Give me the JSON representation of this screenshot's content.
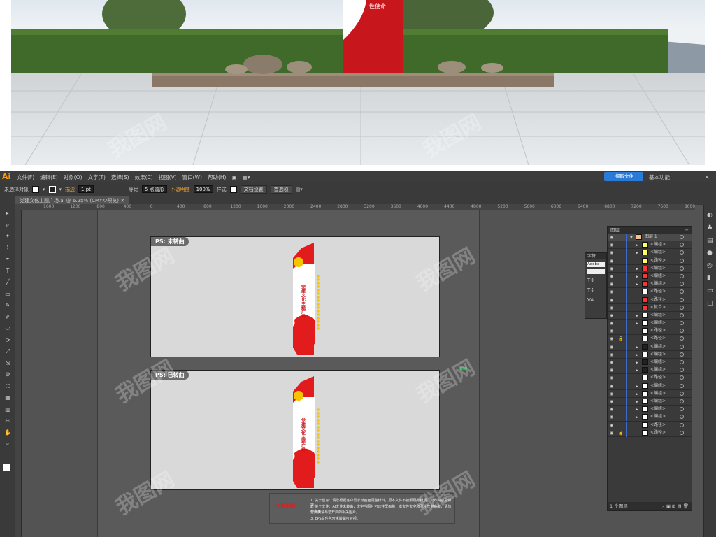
{
  "app": {
    "logo": "Ai",
    "menus": [
      "文件(F)",
      "编辑(E)",
      "对象(O)",
      "文字(T)",
      "选择(S)",
      "效果(C)",
      "视图(V)",
      "窗口(W)",
      "帮助(H)"
    ],
    "cloud_button": "摄取文件",
    "workspace": "基本功能"
  },
  "options_bar": {
    "selection": "未选择对象",
    "stroke_label": "描边",
    "stroke_weight": "1 pt",
    "stroke_style": "等比",
    "brush": "5 点圆形",
    "opacity_label": "不透明度",
    "opacity_value": "100%",
    "style_label": "样式",
    "doc_setup": "文档设置",
    "preferences": "首选项"
  },
  "document": {
    "tab": "党建文化主题广场.ai @ 6.25% (CMYK/预览)",
    "ruler_ticks": [
      "1600",
      "1200",
      "800",
      "400",
      "0",
      "400",
      "800",
      "1200",
      "1600",
      "2000",
      "2400",
      "2800",
      "3200",
      "3600",
      "4000",
      "4400",
      "4800",
      "5200",
      "5600",
      "6000",
      "6400",
      "6800",
      "7200",
      "7600",
      "8000"
    ]
  },
  "artboards": [
    {
      "label": "PS: 未转曲",
      "sign_title": "党建文化主题广场"
    },
    {
      "label": "PS: 已转曲",
      "sign_title": "党建文化主题广场"
    }
  ],
  "file_note": {
    "heading": "文件说明:",
    "lines": [
      "1. 关于创意：请您根据客户需求对画面调整材料，原本文件不按照原有材质，公布内容是做排。",
      "2. 关于文件：AI文件未转曲，文字当图片可以往里面拖，本文件文字和图片仅供参考，请勿在商用",
      "         您负责请与您开启的相关图片。",
      "3. EPS文件包含未转曲可对视。"
    ]
  },
  "char_panel": {
    "title": "字符",
    "font": "Adobe"
  },
  "layers": {
    "title": "图层",
    "footer": "1 个图层",
    "rows": [
      {
        "name": "图层 1",
        "thumb": "#f0c090",
        "top": true
      },
      {
        "name": "<编组>",
        "thumb": "#ffff66",
        "arrow": true
      },
      {
        "name": "<编组>",
        "thumb": "#ffff66",
        "arrow": true
      },
      {
        "name": "<路径>",
        "thumb": "#ffff66"
      },
      {
        "name": "<编组>",
        "thumb": "#ff3333",
        "arrow": true
      },
      {
        "name": "<编组>",
        "thumb": "#ff3333",
        "arrow": true
      },
      {
        "name": "<编组>",
        "thumb": "#ff3333",
        "arrow": true
      },
      {
        "name": "<路径>",
        "thumb": "#ffffff"
      },
      {
        "name": "<路径>",
        "thumb": "#ff3333"
      },
      {
        "name": "<复合>",
        "thumb": "#ff3333"
      },
      {
        "name": "<编组>",
        "thumb": "#ffffff",
        "arrow": true
      },
      {
        "name": "<编组>",
        "thumb": "#ffffff",
        "arrow": true
      },
      {
        "name": "<路径>",
        "thumb": "#ffffff"
      },
      {
        "name": "<路径>",
        "thumb": "#ffffff",
        "locked": true
      },
      {
        "name": "<编组>",
        "thumb": "#222222",
        "arrow": true
      },
      {
        "name": "<编组>",
        "thumb": "#ffffff",
        "arrow": true
      },
      {
        "name": "<编组>",
        "thumb": "#222222",
        "arrow": true
      },
      {
        "name": "<编组>",
        "thumb": "#222222",
        "arrow": true
      },
      {
        "name": "<路径>",
        "thumb": "#ffffff"
      },
      {
        "name": "<编组>",
        "thumb": "#ffffff",
        "arrow": true
      },
      {
        "name": "<编组>",
        "thumb": "#ffffff",
        "arrow": true
      },
      {
        "name": "<编组>",
        "thumb": "#ffffff",
        "arrow": true
      },
      {
        "name": "<编组>",
        "thumb": "#ffffff",
        "arrow": true
      },
      {
        "name": "<编组>",
        "thumb": "#ffffff",
        "arrow": true
      },
      {
        "name": "<路径>",
        "thumb": "#ffffff"
      },
      {
        "name": "<路径>",
        "thumb": "#ffffff",
        "locked": true
      }
    ]
  },
  "colors": {
    "party_red": "#e21c1c",
    "gold": "#f5c400",
    "ui_dark": "#3a3a3a",
    "selection_blue": "#3b6ccd"
  }
}
